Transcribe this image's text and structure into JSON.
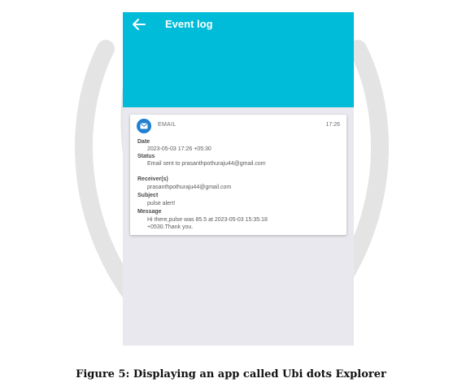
{
  "app_bar": {
    "title": "Event log",
    "back_icon": "arrow-left-icon",
    "color": "#00bcd8"
  },
  "event": {
    "icon": "email-icon",
    "type": "EMAIL",
    "time": "17:26",
    "fields": {
      "date_label": "Date",
      "date_value": "2023-05-03 17:26 +05:30",
      "status_label": "Status",
      "status_value": "Email sent to prasanthpothuraju44@gmail.com",
      "receivers_label": "Receiver(s)",
      "receivers_value": "prasanthpothuraju44@gmail.com",
      "subject_label": "Subject",
      "subject_value": "pulse alert!",
      "message_label": "Message",
      "message_line1": "Hi there,pulse was 85.5 at 2023-05-03 15:35:18",
      "message_line2": "+0530.Thank you."
    }
  },
  "caption": "Figure 5: Displaying an app called Ubi dots Explorer",
  "colors": {
    "screen_background": "#e9e8ee",
    "card_background": "#ffffff"
  }
}
